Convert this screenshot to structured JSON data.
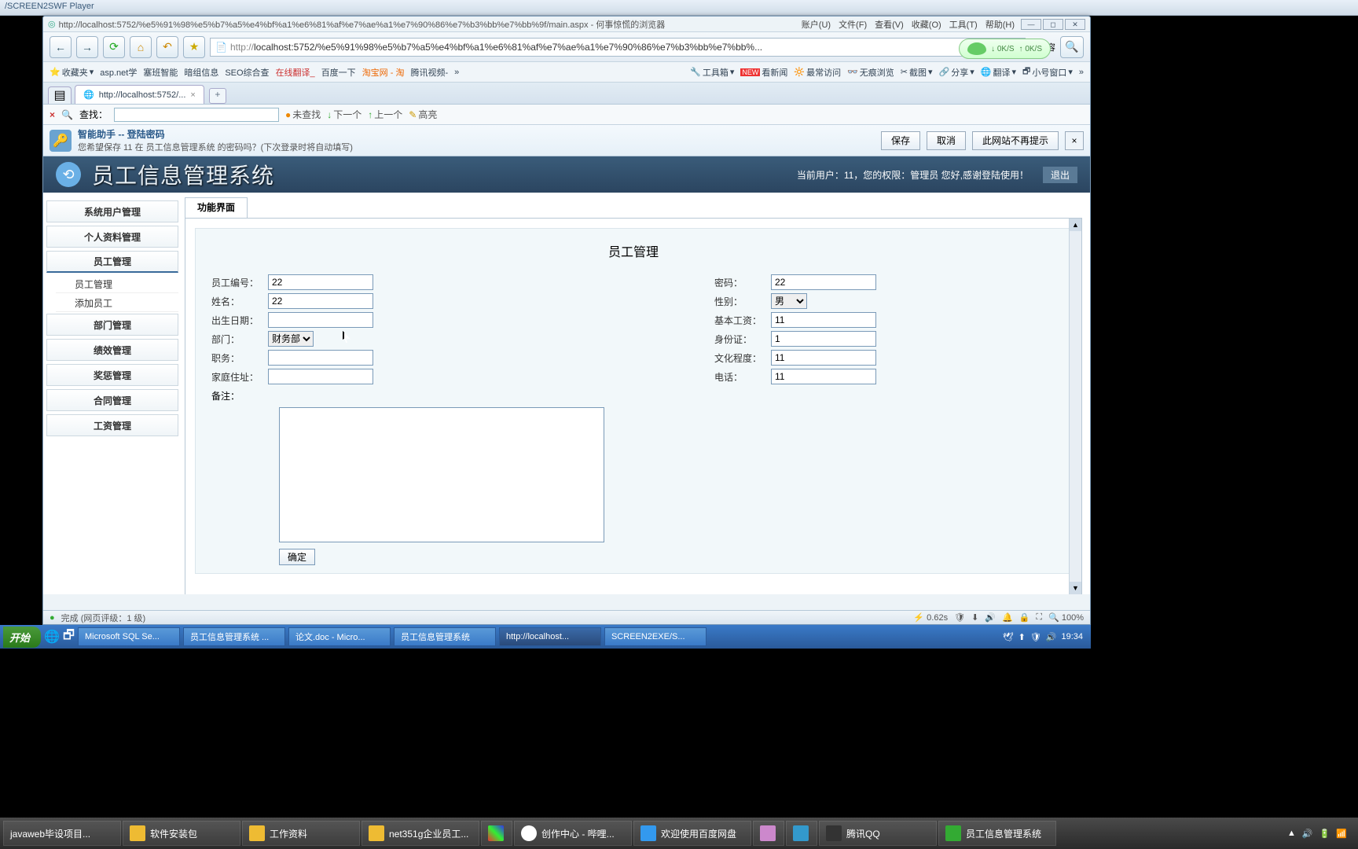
{
  "window": {
    "title": "/SCREEN2SWF Player"
  },
  "browser": {
    "page_url_display": "http://localhost:5752/%e5%91%98%e5%b7%a5%e4%bf%a1%e6%81%af%e7%ae%a1%e7%90%86%e7%b3%bb%e7%bb%9f/main.aspx - 何事惊慌的浏览器",
    "menus": {
      "account": "账户(U)",
      "file": "文件(F)",
      "view": "查看(V)",
      "fav": "收藏(O)",
      "tool": "工具(T)",
      "help": "帮助(H)"
    },
    "speed": {
      "down": "0K/S",
      "up": "0K/S"
    },
    "url_protocol": "http://",
    "url_rest": "localhost:5752/%e5%91%98%e5%b7%a5%e4%bf%a1%e6%81%af%e7%ae%a1%e7%90%86%e7%b3%bb%e7%bb%...",
    "compat": "兼容",
    "bookmarks_left": [
      "收藏夹",
      "asp.net学",
      "塞班智能",
      "暗组信息",
      "SEO综合查",
      "在线翻译_",
      "百度一下",
      "淘宝网 - 淘",
      "腾讯视频-"
    ],
    "bookmarks_right": [
      "工具箱",
      "看新闻",
      "最常访问",
      "无痕浏览",
      "截图",
      "分享",
      "翻译",
      "小号窗口"
    ],
    "tab_label": "http://localhost:5752/...",
    "find": {
      "label": "查找：",
      "no_result": "未查找",
      "next": "下一个",
      "prev": "上一个",
      "highlight": "高亮"
    },
    "password_bar": {
      "title": "智能助手 -- 登陆密码",
      "msg": "您希望保存 11 在 员工信息管理系统 的密码吗？(下次登录时将自动填写)",
      "save": "保存",
      "cancel": "取消",
      "never": "此网站不再提示"
    },
    "status": {
      "done": "完成 (网页评级：1 级)",
      "time": "0.62s",
      "zoom": "100%"
    }
  },
  "app": {
    "title": "员工信息管理系统",
    "user_line": "当前用户：11，您的权限：管理员 您好,感谢登陆使用！",
    "logout": "退出",
    "sidebar": {
      "items": [
        "系统用户管理",
        "个人资料管理",
        "员工管理",
        "",
        "",
        "部门管理",
        "绩效管理",
        "奖惩管理",
        "合同管理",
        "工资管理"
      ],
      "subitems": [
        "员工管理",
        "添加员工"
      ]
    },
    "tab": "功能界面",
    "form": {
      "title": "员工管理",
      "left": {
        "emp_no_l": "员工编号：",
        "emp_no_v": "22",
        "name_l": "姓名：",
        "name_v": "22",
        "birth_l": "出生日期：",
        "birth_v": "",
        "dept_l": "部门：",
        "dept_v": "财务部",
        "post_l": "职务：",
        "post_v": "",
        "addr_l": "家庭住址：",
        "addr_v": "",
        "remark_l": "备注："
      },
      "right": {
        "pwd_l": "密码：",
        "pwd_v": "22",
        "gender_l": "性别：",
        "gender_v": "男",
        "salary_l": "基本工资：",
        "salary_v": "11",
        "idcard_l": "身份证：",
        "idcard_v": "1",
        "edu_l": "文化程度：",
        "edu_v": "11",
        "phone_l": "电话：",
        "phone_v": "11"
      },
      "submit": "确定"
    }
  },
  "taskbar1": {
    "start": "开始",
    "items": [
      "Microsoft SQL Se...",
      "员工信息管理系统 ...",
      "论文.doc - Micro...",
      "员工信息管理系统",
      "http://localhost...",
      "SCREEN2EXE/S..."
    ],
    "time": "19:34"
  },
  "taskbar2": {
    "items": [
      "javaweb毕设项目...",
      "软件安装包",
      "工作资料",
      "net351g企业员工...",
      "",
      "创作中心 - 哔哩...",
      "欢迎使用百度网盘",
      "",
      "",
      "腾讯QQ",
      "员工信息管理系统"
    ],
    "time": ""
  }
}
